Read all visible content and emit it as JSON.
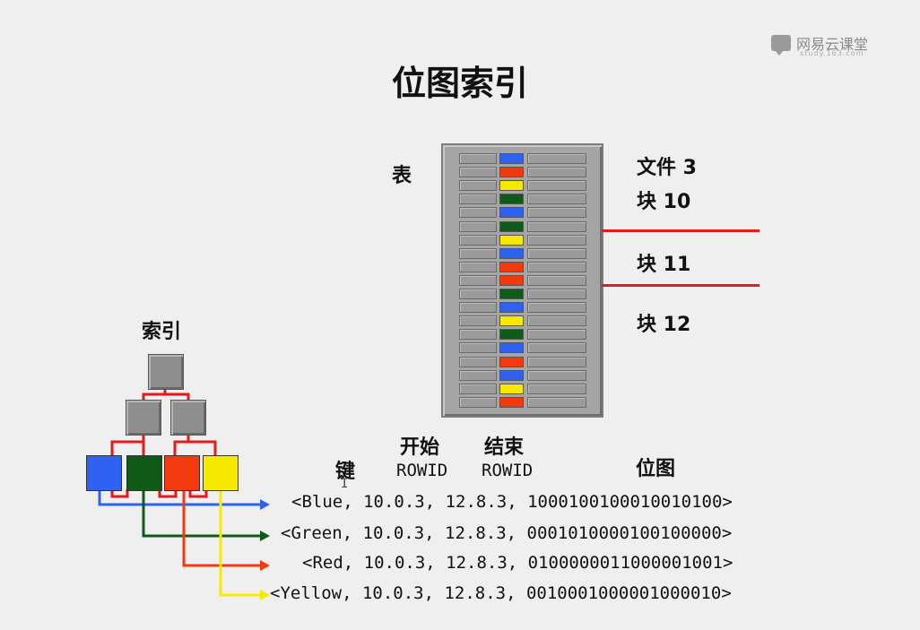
{
  "slide": {
    "title": "位图索引",
    "logo": {
      "brand": "网易云课堂",
      "sub": "study.163.com",
      "icon": "speech-bubble-icon"
    }
  },
  "table_diagram": {
    "label": "表",
    "file_label": "文件 3",
    "blocks": [
      "块 10",
      "块 11",
      "块 12"
    ],
    "row_colors": [
      "blue",
      "red",
      "yellow",
      "green",
      "blue",
      "green",
      "yellow",
      "blue",
      "red",
      "red",
      "green",
      "blue",
      "yellow",
      "green",
      "blue",
      "red",
      "blue",
      "yellow",
      "red"
    ]
  },
  "index_tree": {
    "label": "索引",
    "leaf_colors": [
      "blue",
      "green",
      "red",
      "yellow"
    ]
  },
  "headers": {
    "key": "键",
    "start": "开始",
    "start_rowid": "ROWID",
    "end": "结束",
    "end_rowid": "ROWID",
    "bitmap": "位图"
  },
  "entries": [
    {
      "text": "<Blue, 10.0.3, 12.8.3, 1000100100010010100>",
      "color": "blue"
    },
    {
      "text": "<Green, 10.0.3, 12.8.3, 0001010000100100000>",
      "color": "green"
    },
    {
      "text": "<Red, 10.0.3, 12.8.3, 0100000011000001001>",
      "color": "red"
    },
    {
      "text": "<Yellow, 10.0.3, 12.8.3, 0010001000001000010>",
      "color": "yellow"
    }
  ],
  "colors": {
    "blue": "#2f62f0",
    "green": "#0f5a18",
    "red": "#f23a0e",
    "yellow": "#f7ea00",
    "line_red": "#e51a1a"
  }
}
